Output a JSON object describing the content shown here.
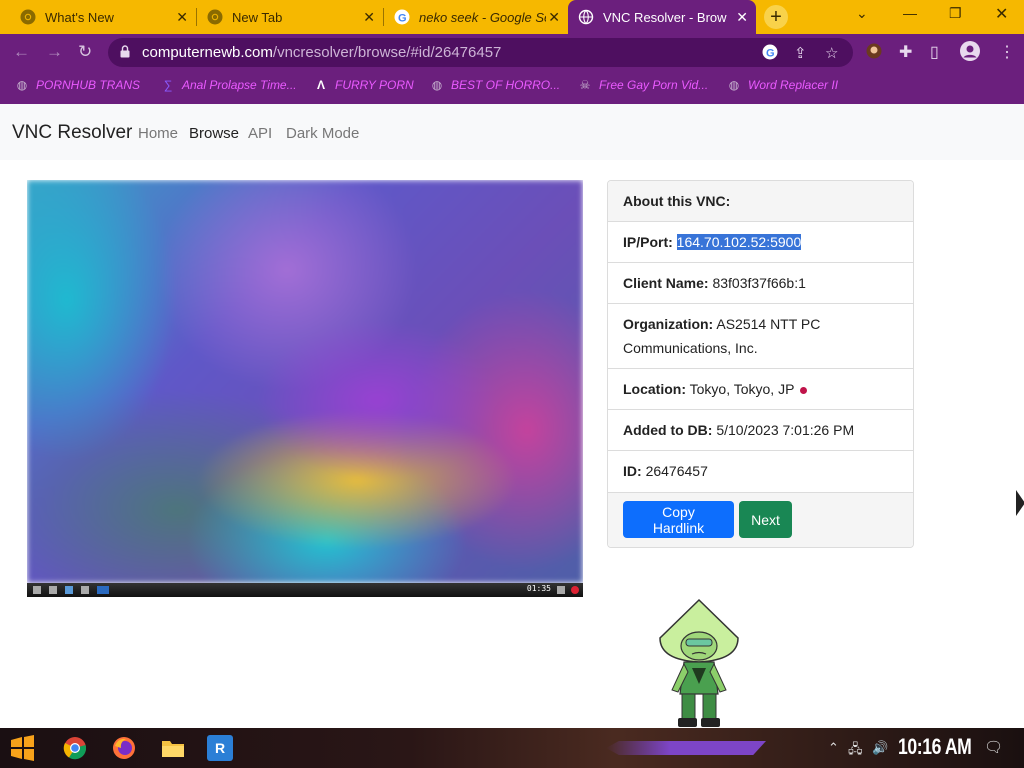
{
  "browser": {
    "tabs": [
      {
        "title": "What's New",
        "icon": "chrome-icon"
      },
      {
        "title": "New Tab",
        "icon": "chrome-icon"
      },
      {
        "title": "neko seek - Google Se",
        "icon": "google-icon"
      },
      {
        "title": "VNC Resolver - Brows",
        "icon": "globe-icon",
        "active": true
      }
    ],
    "url_domain": "computernewb.com",
    "url_path": "/vncresolver/browse/#id/26476457",
    "bookmarks": [
      {
        "label": "PORNHUB TRANS",
        "icon": "globe-icon"
      },
      {
        "label": "Anal Prolapse Time...",
        "icon": "bookmark-icon"
      },
      {
        "label": "FURRY PORN",
        "icon": "lambda-icon"
      },
      {
        "label": "BEST OF HORRO...",
        "icon": "globe-icon"
      },
      {
        "label": "Free Gay Porn Vid...",
        "icon": "skull-icon"
      },
      {
        "label": "Word Replacer II",
        "icon": "globe-icon"
      }
    ]
  },
  "site": {
    "brand": "VNC Resolver",
    "nav": [
      "Home",
      "Browse",
      "API",
      "Dark Mode"
    ],
    "current_nav": "Browse"
  },
  "vnc": {
    "clock": "01:35"
  },
  "card": {
    "header": "About this VNC:",
    "rows": [
      {
        "label": "IP/Port:",
        "value": "164.70.102.52:5900"
      },
      {
        "label": "Client Name:",
        "value": "83f03f37f66b:1"
      },
      {
        "label": "Organization:",
        "value": "AS2514 NTT PC Communications, Inc."
      },
      {
        "label": "Location:",
        "value": "Tokyo, Tokyo, JP"
      },
      {
        "label": "Added to DB:",
        "value": "5/10/2023 7:01:26 PM"
      },
      {
        "label": "ID:",
        "value": "26476457"
      }
    ],
    "copy_button": "Copy Hardlink",
    "next_button": "Next"
  },
  "taskbar": {
    "clock": "10:16 AM"
  },
  "colors": {
    "tab_bar": "#f6b800",
    "browser_theme": "#6b1f7d",
    "bookmark_text": "#ea5aff",
    "primary": "#0d6efd",
    "success": "#198754",
    "selection": "#3874d8",
    "flag_dot": "#c0134a"
  }
}
